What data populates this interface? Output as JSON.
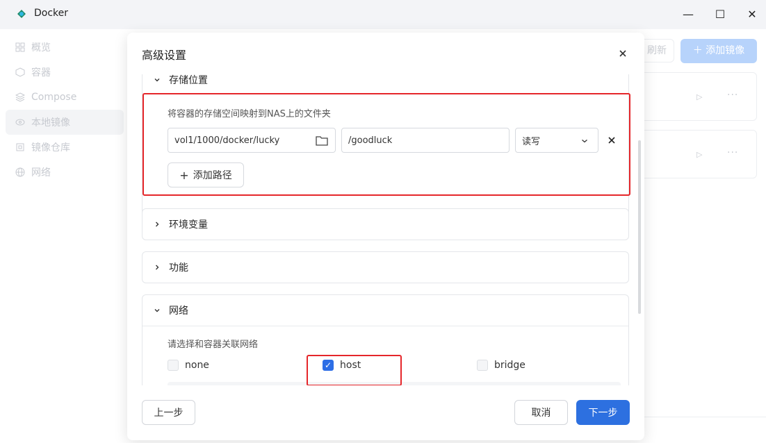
{
  "window": {
    "title": "Docker",
    "controls": {
      "minimize": "—",
      "maximize": "☐",
      "close": "✕"
    }
  },
  "sidebar": {
    "items": [
      {
        "label": "概览",
        "icon": "grid-icon"
      },
      {
        "label": "容器",
        "icon": "cube-icon"
      },
      {
        "label": "Compose",
        "icon": "layers-icon"
      },
      {
        "label": "本地镜像",
        "icon": "disc-icon",
        "active": true
      },
      {
        "label": "镜像仓库",
        "icon": "registry-icon"
      },
      {
        "label": "网络",
        "icon": "globe-icon"
      }
    ]
  },
  "background": {
    "refresh_label": "刷新",
    "add_image_label": "＋ 添加镜像"
  },
  "dialog": {
    "title": "高级设置",
    "storage": {
      "title": "存储位置",
      "hint": "将容器的存储空间映射到NAS上的文件夹",
      "host_path": "vol1/1000/docker/lucky",
      "container_path": "/goodluck",
      "permission": "读写",
      "add_path_label": "添加路径"
    },
    "env": {
      "title": "环境变量"
    },
    "features": {
      "title": "功能"
    },
    "network": {
      "title": "网络",
      "hint": "请选择和容器关联网络",
      "options": [
        {
          "label": "none",
          "checked": false
        },
        {
          "label": "host",
          "checked": true
        },
        {
          "label": "bridge",
          "checked": false
        }
      ]
    },
    "footer": {
      "prev_label": "上一步",
      "cancel_label": "取消",
      "next_label": "下一步"
    }
  },
  "colors": {
    "primary": "#2d70e0",
    "highlight": "#e5262a"
  }
}
